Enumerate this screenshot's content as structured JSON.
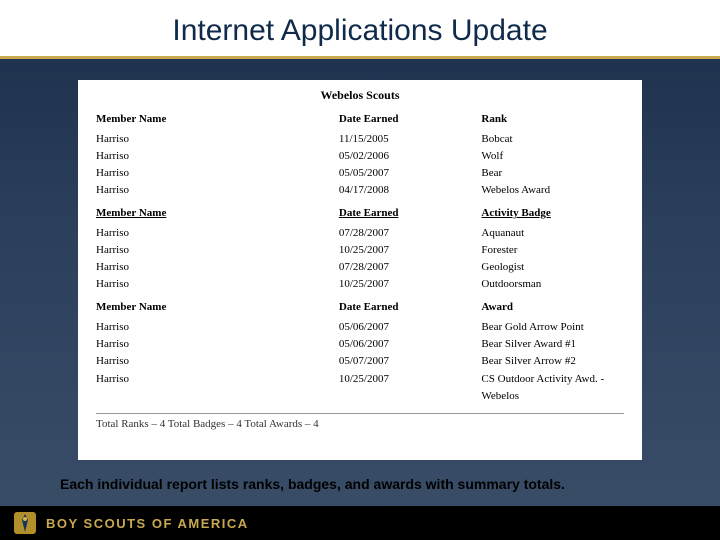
{
  "title": "Internet Applications Update",
  "panel_title": "Webelos Scouts",
  "sections": [
    {
      "headers": {
        "c1": "Member Name",
        "c2": "Date Earned",
        "c3": "Rank"
      },
      "underline": false,
      "rows": [
        {
          "c1": "Harriso",
          "c2": "11/15/2005",
          "c3": "Bobcat"
        },
        {
          "c1": "Harriso",
          "c2": "05/02/2006",
          "c3": "Wolf"
        },
        {
          "c1": "Harriso",
          "c2": "05/05/2007",
          "c3": "Bear"
        },
        {
          "c1": "Harriso",
          "c2": "04/17/2008",
          "c3": "Webelos Award"
        }
      ]
    },
    {
      "headers": {
        "c1": "Member Name",
        "c2": "Date Earned",
        "c3": "Activity Badge"
      },
      "underline": true,
      "rows": [
        {
          "c1": "Harriso",
          "c2": "07/28/2007",
          "c3": "Aquanaut"
        },
        {
          "c1": "Harriso",
          "c2": "10/25/2007",
          "c3": "Forester"
        },
        {
          "c1": "Harriso",
          "c2": "07/28/2007",
          "c3": "Geologist"
        },
        {
          "c1": "Harriso",
          "c2": "10/25/2007",
          "c3": "Outdoorsman"
        }
      ]
    },
    {
      "headers": {
        "c1": "Member Name",
        "c2": "Date Earned",
        "c3": "Award"
      },
      "underline": false,
      "rows": [
        {
          "c1": "Harriso",
          "c2": "05/06/2007",
          "c3": "Bear Gold Arrow Point"
        },
        {
          "c1": "Harriso",
          "c2": "05/06/2007",
          "c3": "Bear Silver Award #1"
        },
        {
          "c1": "Harriso",
          "c2": "05/07/2007",
          "c3": "Bear Silver Arrow #2"
        },
        {
          "c1": "Harriso",
          "c2": "10/25/2007",
          "c3": "CS Outdoor Activity Awd. - Webelos"
        }
      ]
    }
  ],
  "totals_line": "Total Ranks – 4  Total Badges – 4  Total Awards – 4",
  "caption": "Each individual report lists ranks, badges, and awards with summary totals.",
  "footer_text": "BOY SCOUTS OF AMERICA"
}
